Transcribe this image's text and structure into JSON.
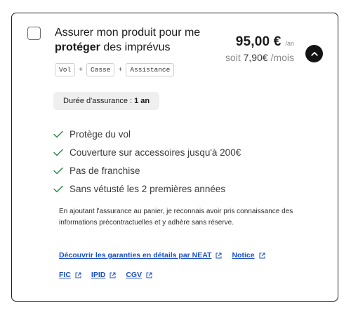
{
  "product": {
    "title_part1": "Assurer mon produit pour me ",
    "title_bold": "protéger",
    "title_part2": " des imprévus",
    "tags": [
      "Vol",
      "Casse",
      "Assistance"
    ],
    "tag_separator": "+"
  },
  "pricing": {
    "price": "95,00 €",
    "period": "/an",
    "monthly_prefix": "soit ",
    "monthly_value": "7,90€",
    "monthly_suffix": " /mois"
  },
  "duration": {
    "label": "Durée d'assurance :",
    "value": "1 an"
  },
  "features": [
    "Protège du vol",
    "Couverture sur accessoires jusqu'à 200€",
    "Pas de franchise",
    "Sans vétusté les 2 premières années"
  ],
  "disclaimer": "En ajoutant l'assurance au panier, je reconnais avoir pris connaissance des informations précontractuelles et y adhère sans réserve.",
  "links": {
    "row1": [
      "Découvrir les garanties en détails par NEAT",
      "Notice"
    ],
    "row2": [
      "FIC",
      "IPID",
      "CGV"
    ]
  },
  "icons": {
    "checkbox": "checkbox-icon",
    "collapse": "chevron-up-icon",
    "feature": "check-icon",
    "external": "external-link-icon"
  },
  "colors": {
    "link": "#1d4fc4",
    "check": "#1e8a3c",
    "chip_bg": "#efefef",
    "collapse_bg": "#141414"
  }
}
